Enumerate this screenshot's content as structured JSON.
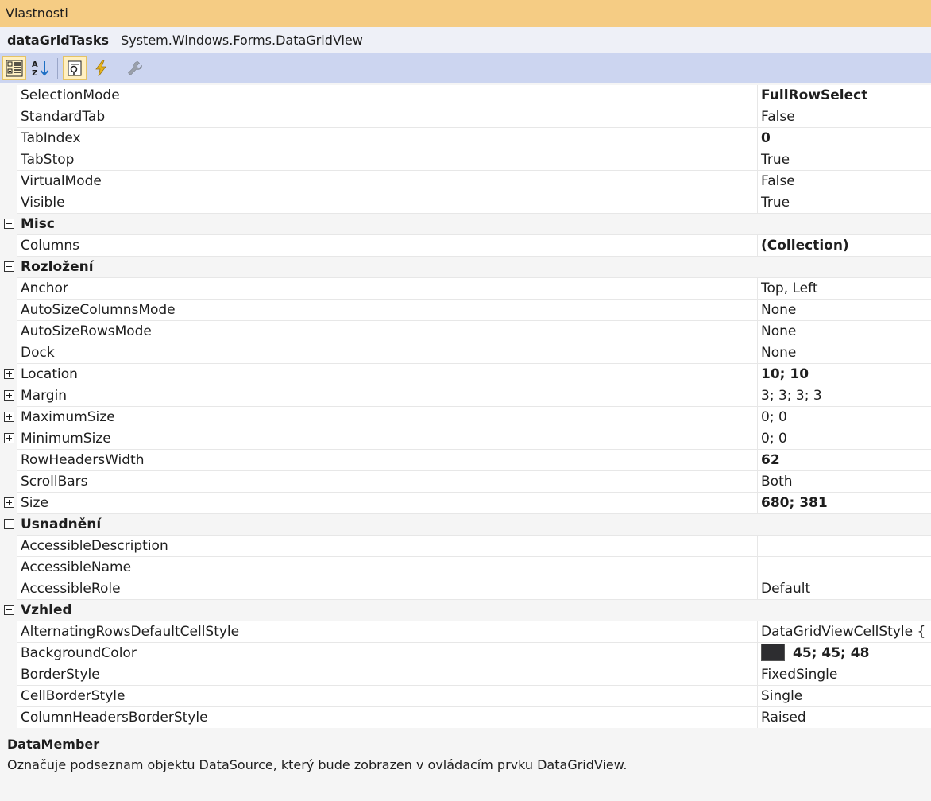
{
  "window": {
    "title": "Vlastnosti"
  },
  "object": {
    "name": "dataGridTasks",
    "type": "System.Windows.Forms.DataGridView"
  },
  "toolbar": {
    "buttons": [
      {
        "icon": "categorized-icon",
        "active": true
      },
      {
        "icon": "alphabetical-icon",
        "active": false
      },
      {
        "icon": "properties-icon",
        "active": true
      },
      {
        "icon": "events-icon",
        "active": false
      },
      {
        "icon": "property-pages-icon",
        "active": false
      }
    ]
  },
  "grid": {
    "rows": [
      {
        "kind": "prop",
        "name": "SelectionMode",
        "value": "FullRowSelect",
        "bold": true
      },
      {
        "kind": "prop",
        "name": "StandardTab",
        "value": "False"
      },
      {
        "kind": "prop",
        "name": "TabIndex",
        "value": "0",
        "bold": true
      },
      {
        "kind": "prop",
        "name": "TabStop",
        "value": "True"
      },
      {
        "kind": "prop",
        "name": "VirtualMode",
        "value": "False"
      },
      {
        "kind": "prop",
        "name": "Visible",
        "value": "True"
      },
      {
        "kind": "category",
        "name": "Misc"
      },
      {
        "kind": "prop",
        "name": "Columns",
        "value": "(Collection)",
        "bold": true
      },
      {
        "kind": "category",
        "name": "Rozložení"
      },
      {
        "kind": "prop",
        "name": "Anchor",
        "value": "Top, Left"
      },
      {
        "kind": "prop",
        "name": "AutoSizeColumnsMode",
        "value": "None"
      },
      {
        "kind": "prop",
        "name": "AutoSizeRowsMode",
        "value": "None"
      },
      {
        "kind": "prop",
        "name": "Dock",
        "value": "None"
      },
      {
        "kind": "prop",
        "name": "Location",
        "value": "10; 10",
        "bold": true,
        "expandable": true
      },
      {
        "kind": "prop",
        "name": "Margin",
        "value": "3; 3; 3; 3",
        "expandable": true
      },
      {
        "kind": "prop",
        "name": "MaximumSize",
        "value": "0; 0",
        "expandable": true
      },
      {
        "kind": "prop",
        "name": "MinimumSize",
        "value": "0; 0",
        "expandable": true
      },
      {
        "kind": "prop",
        "name": "RowHeadersWidth",
        "value": "62",
        "bold": true
      },
      {
        "kind": "prop",
        "name": "ScrollBars",
        "value": "Both"
      },
      {
        "kind": "prop",
        "name": "Size",
        "value": "680; 381",
        "bold": true,
        "expandable": true
      },
      {
        "kind": "category",
        "name": "Usnadnění"
      },
      {
        "kind": "prop",
        "name": "AccessibleDescription",
        "value": ""
      },
      {
        "kind": "prop",
        "name": "AccessibleName",
        "value": ""
      },
      {
        "kind": "prop",
        "name": "AccessibleRole",
        "value": "Default"
      },
      {
        "kind": "category",
        "name": "Vzhled"
      },
      {
        "kind": "prop",
        "name": "AlternatingRowsDefaultCellStyle",
        "value": "DataGridViewCellStyle { }"
      },
      {
        "kind": "prop",
        "name": "BackgroundColor",
        "value": "45; 45; 48",
        "bold": true,
        "swatch": "#2d2d30"
      },
      {
        "kind": "prop",
        "name": "BorderStyle",
        "value": "FixedSingle"
      },
      {
        "kind": "prop",
        "name": "CellBorderStyle",
        "value": "Single"
      },
      {
        "kind": "prop",
        "name": "ColumnHeadersBorderStyle",
        "value": "Raised"
      }
    ]
  },
  "description": {
    "title": "DataMember",
    "text": "Označuje podseznam objektu DataSource, který bude zobrazen v ovládacím prvku DataGridView."
  }
}
